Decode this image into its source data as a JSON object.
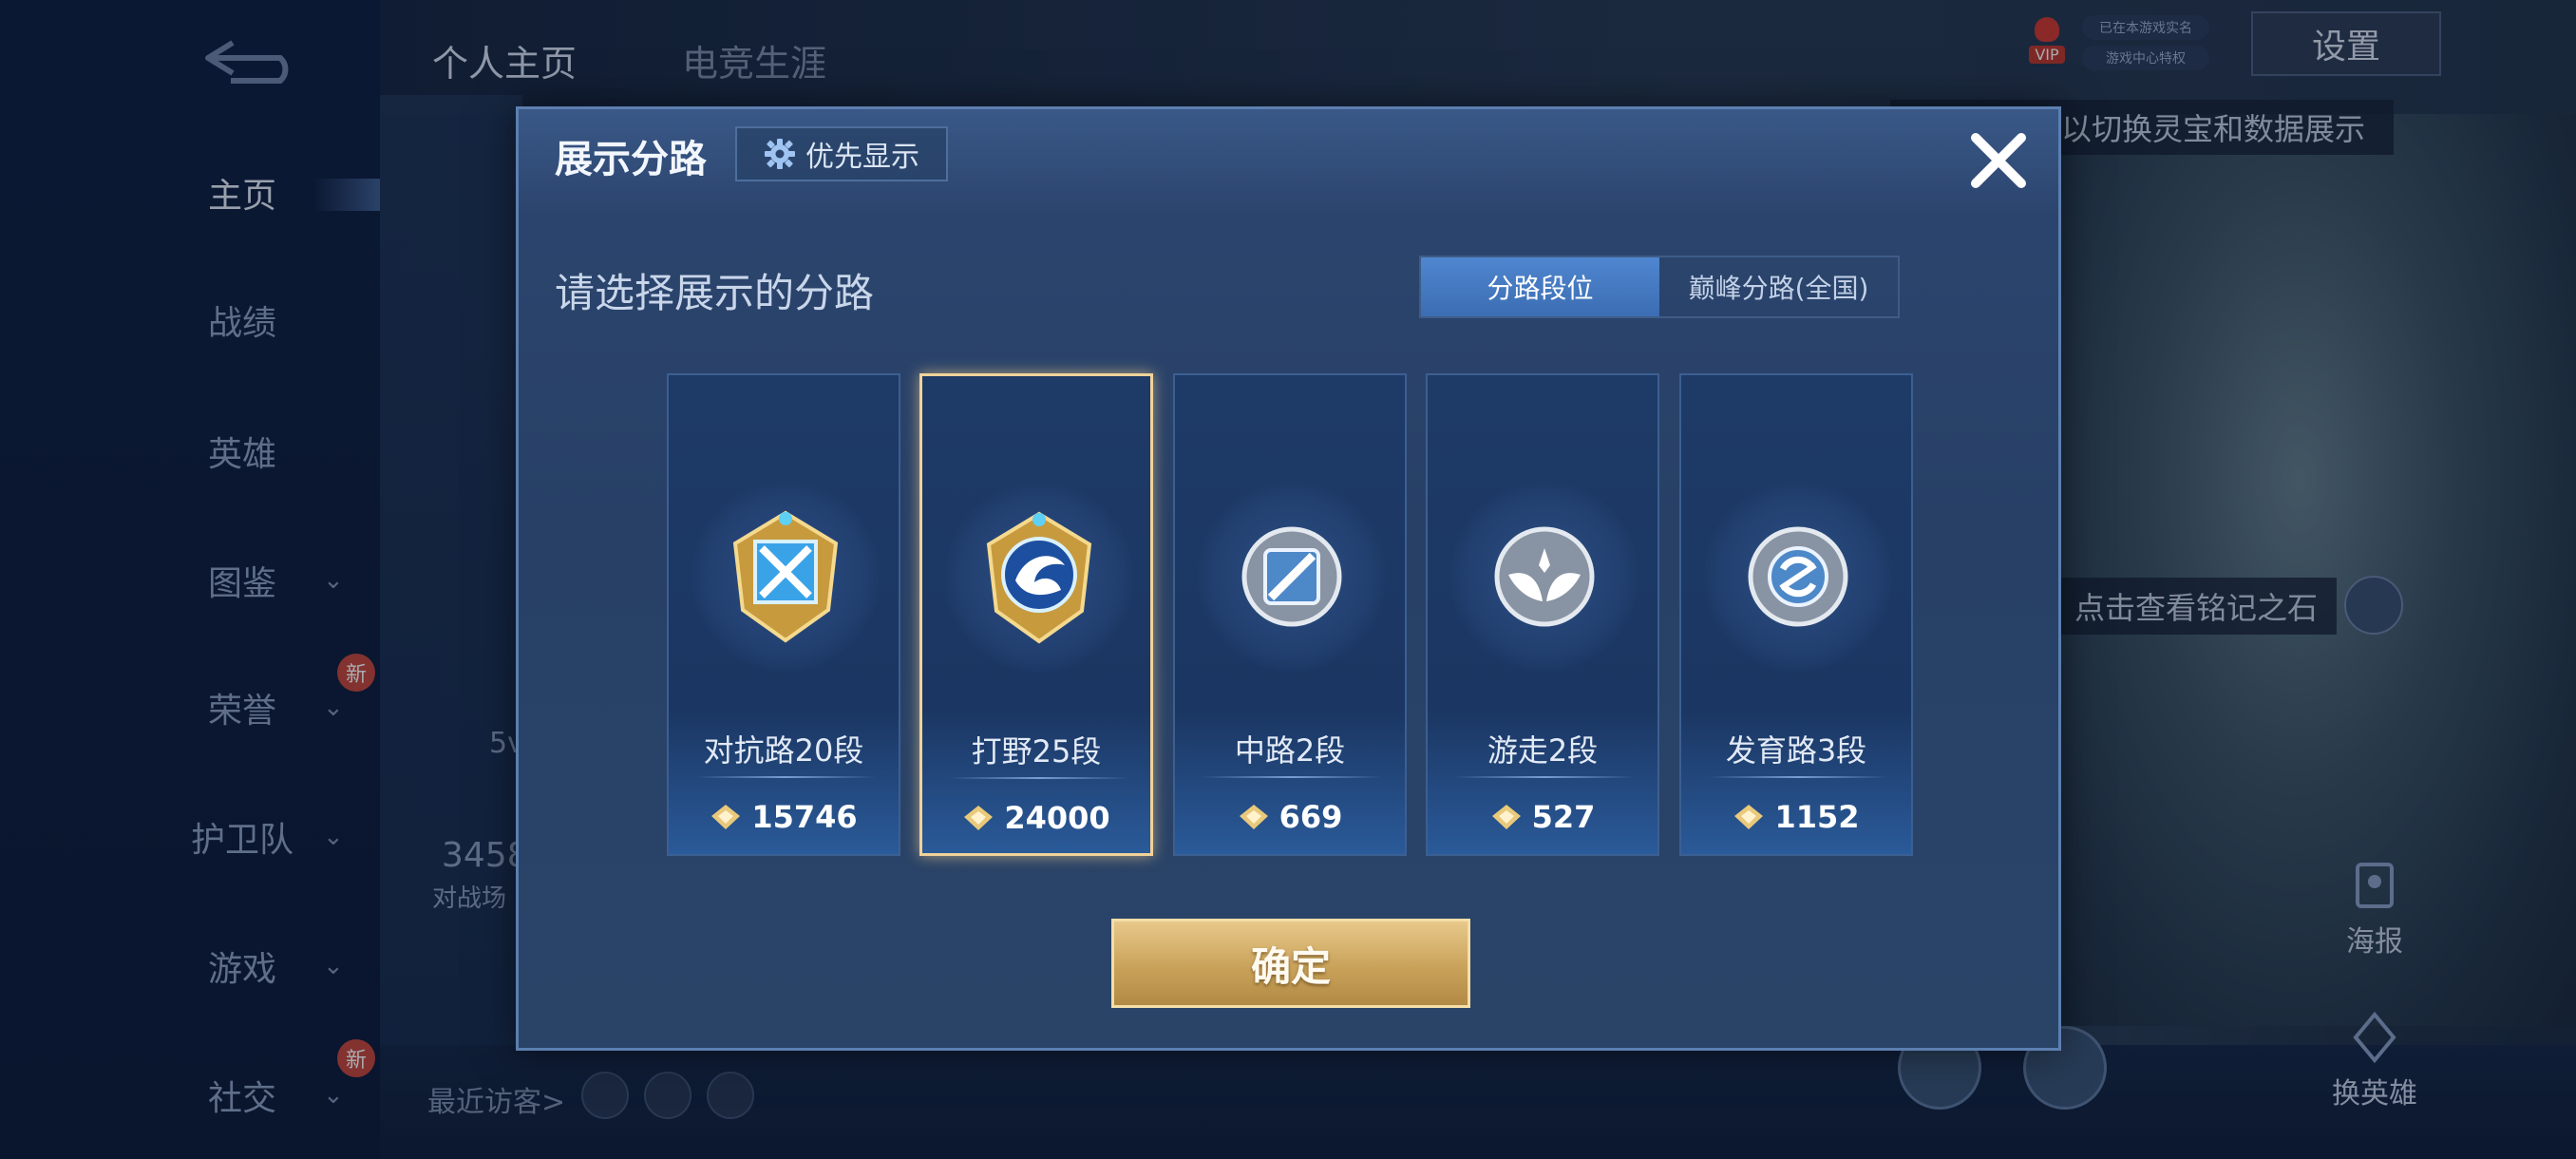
{
  "sidebar": {
    "items": [
      {
        "label": "主页",
        "chevron": false,
        "new": false,
        "active": true
      },
      {
        "label": "战绩",
        "chevron": false,
        "new": false,
        "active": false
      },
      {
        "label": "英雄",
        "chevron": false,
        "new": false,
        "active": false
      },
      {
        "label": "图鉴",
        "chevron": true,
        "new": false,
        "active": false
      },
      {
        "label": "荣誉",
        "chevron": true,
        "new": true,
        "active": false
      },
      {
        "label": "护卫队",
        "chevron": true,
        "new": false,
        "active": false
      },
      {
        "label": "游戏",
        "chevron": true,
        "new": false,
        "active": false
      },
      {
        "label": "社交",
        "chevron": true,
        "new": true,
        "active": false
      }
    ],
    "new_badge": "新"
  },
  "top_tabs": [
    "个人主页",
    "电竞生涯"
  ],
  "top_right": {
    "vip": "VIP",
    "pill1": "已在本游戏实名",
    "pill2": "游戏中心特权",
    "settings": "设置",
    "tip": "以切换灵宝和数据展示"
  },
  "behind": {
    "inscription_tip": "点击查看铭记之石",
    "poster_label": "海报",
    "switch_hero_label": "换英雄",
    "recent_visitors": "最近访客>",
    "partial_number": "3458",
    "partial_caption": "对战场",
    "partial_5v": "5v"
  },
  "modal": {
    "title": "展示分路",
    "priority_label": "优先显示",
    "prompt": "请选择展示的分路",
    "tabs": [
      {
        "label": "分路段位",
        "active": true
      },
      {
        "label": "巅峰分路(全国)",
        "active": false
      }
    ],
    "lanes": [
      {
        "name": "对抗路20段",
        "score": "15746",
        "selected": false,
        "tier": "gold",
        "icon": "clash-lane-icon"
      },
      {
        "name": "打野25段",
        "score": "24000",
        "selected": true,
        "tier": "gold",
        "icon": "jungle-icon"
      },
      {
        "name": "中路2段",
        "score": "669",
        "selected": false,
        "tier": "silver",
        "icon": "mid-lane-icon"
      },
      {
        "name": "游走2段",
        "score": "527",
        "selected": false,
        "tier": "silver",
        "icon": "roam-icon"
      },
      {
        "name": "发育路3段",
        "score": "1152",
        "selected": false,
        "tier": "silver",
        "icon": "farm-lane-icon"
      }
    ],
    "confirm_label": "确定"
  },
  "colors": {
    "accent_gold": "#e8c98b",
    "tab_active": "#4f86cf",
    "modal_bg": "#2c4670",
    "badge_new": "#c7483a"
  }
}
